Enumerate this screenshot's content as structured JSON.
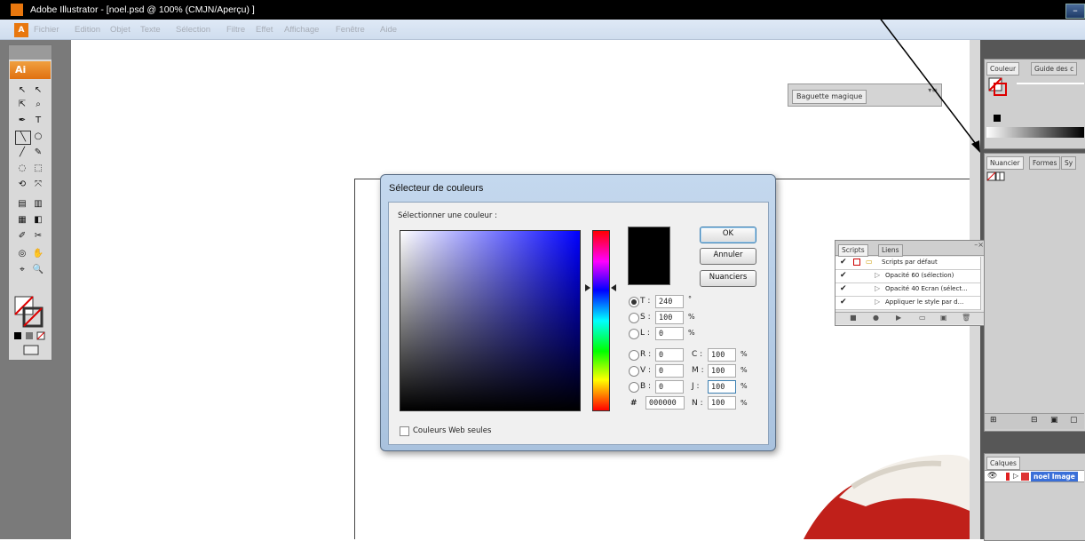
{
  "window": {
    "title": "Adobe Illustrator - [noel.psd @ 100% (CMJN/Aperçu) ]",
    "minimize": "–"
  },
  "menubar": {
    "items": [
      "Fichier",
      "Edition",
      "Objet",
      "Texte",
      "Sélection",
      "Filtre",
      "Effet",
      "Affichage",
      "Fenêtre",
      "Aide"
    ]
  },
  "toolbox": {
    "badge": "Ai",
    "tools": [
      "↖",
      "↖",
      "⇱",
      "⌕",
      "✒",
      "T",
      "╲",
      "○",
      "╱",
      "✎",
      "◌",
      "⬚",
      "⟲",
      "⤧",
      "▤",
      "▥",
      "▦",
      "◧",
      "✐",
      "✂",
      "◎",
      "✋",
      "⌖",
      "🔍"
    ]
  },
  "baguette_panel": {
    "tab": "Baguette magique"
  },
  "color_picker": {
    "title": "Sélecteur de couleurs",
    "select_label": "Sélectionner une couleur :",
    "ok": "OK",
    "cancel": "Annuler",
    "swatches": "Nuanciers",
    "hsb": [
      {
        "label": "T :",
        "value": "240",
        "unit": "°",
        "selected": true
      },
      {
        "label": "S :",
        "value": "100",
        "unit": "%",
        "selected": false
      },
      {
        "label": "L :",
        "value": "0",
        "unit": "%",
        "selected": false
      }
    ],
    "rgb": [
      {
        "label": "R :",
        "value": "0"
      },
      {
        "label": "V :",
        "value": "0"
      },
      {
        "label": "B :",
        "value": "0"
      }
    ],
    "cmyk": [
      {
        "label": "C :",
        "value": "100",
        "unit": "%"
      },
      {
        "label": "M :",
        "value": "100",
        "unit": "%"
      },
      {
        "label": "J :",
        "value": "100",
        "unit": "%"
      },
      {
        "label": "N :",
        "value": "100",
        "unit": "%"
      }
    ],
    "hex_label": "#",
    "hex_value": "000000",
    "web_only": "Couleurs Web seules",
    "preview_color": "#000000"
  },
  "scripts_panel": {
    "tabs": [
      "Scripts",
      "Liens"
    ],
    "rows": [
      "Scripts par défaut",
      "Opacité 60 (sélection)",
      "Opacité 40 Ecran (sélect...",
      "Appliquer le style par d..."
    ]
  },
  "right_panels": {
    "color_tabs": [
      "Couleur",
      "Guide des c"
    ],
    "swatch_tabs": [
      "Nuancier",
      "Formes",
      "Sy"
    ],
    "layers_tab": "Calques",
    "layer_name": "noel Image"
  }
}
